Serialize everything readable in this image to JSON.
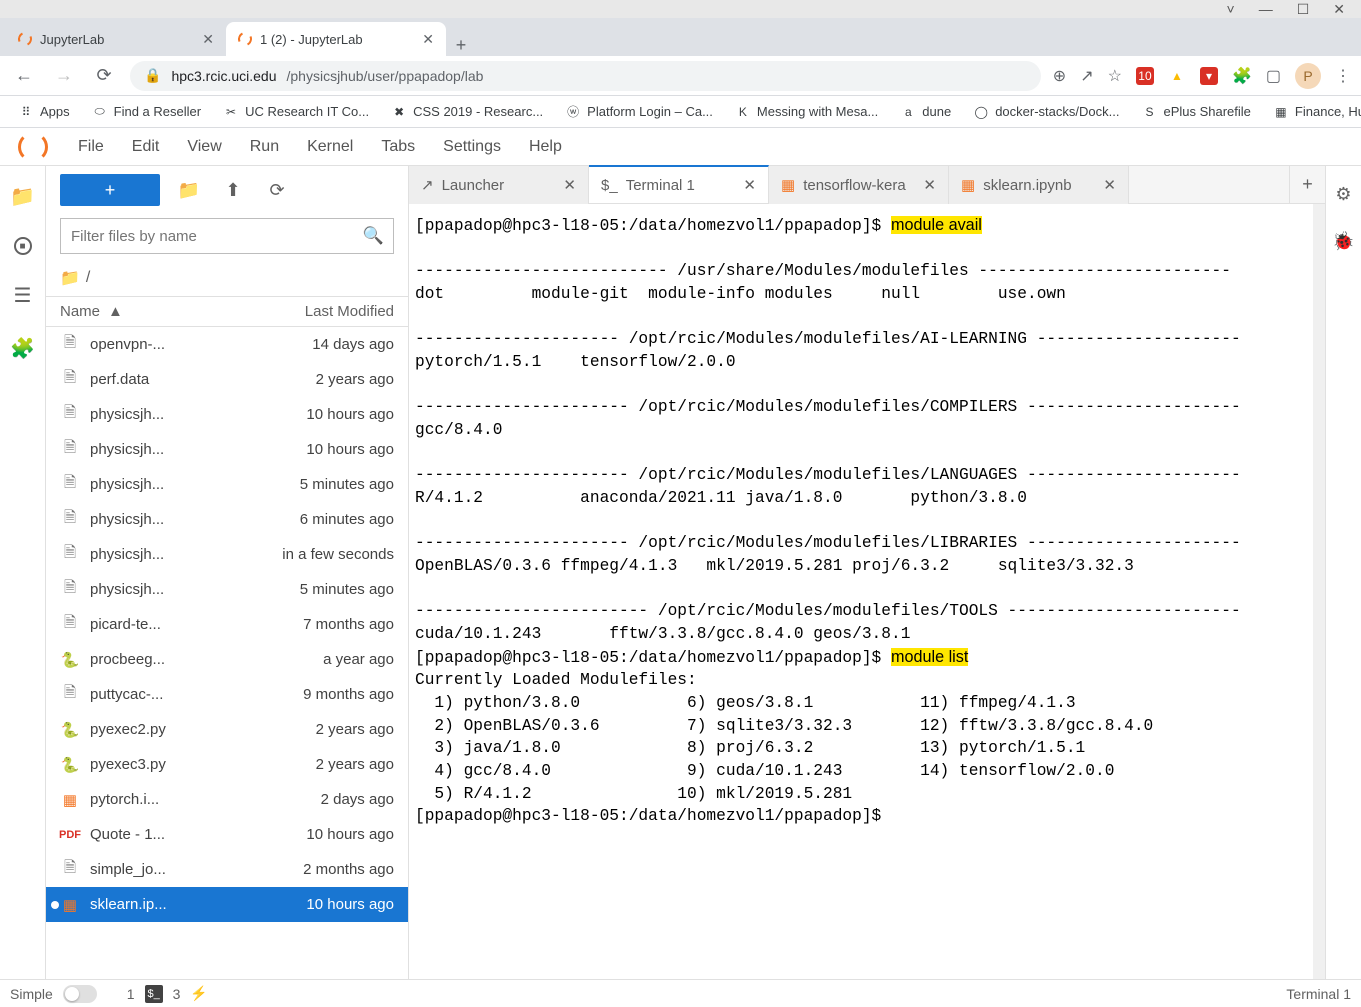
{
  "window": {
    "minimize": "—",
    "maximize": "☐",
    "close": "✕",
    "chevron": "˅"
  },
  "browser_tabs": [
    {
      "title": "JupyterLab",
      "active": false
    },
    {
      "title": "1 (2) - JupyterLab",
      "active": true
    }
  ],
  "address": {
    "secure_icon": "🔒",
    "url_host": "hpc3.rcic.uci.edu",
    "url_path": "/physicsjhub/user/ppapadop/lab"
  },
  "addr_icons": {
    "zoom": "⊕",
    "share": "↗",
    "star": "☆",
    "puzzle": "🧩",
    "panel": "▢",
    "dots": "⋮"
  },
  "bookmarks": [
    {
      "icon": "⠿",
      "label": "Apps"
    },
    {
      "icon": "⬭",
      "label": "Find a Reseller"
    },
    {
      "icon": "✂",
      "label": "UC Research IT Co..."
    },
    {
      "icon": "✖",
      "label": "CSS 2019 - Researc..."
    },
    {
      "icon": "ⓦ",
      "label": "Platform Login – Ca..."
    },
    {
      "icon": "K",
      "label": "Messing with Mesa..."
    },
    {
      "icon": "a",
      "label": "dune"
    },
    {
      "icon": "◯",
      "label": "docker-stacks/Dock..."
    },
    {
      "icon": "S",
      "label": "ePlus Sharefile"
    },
    {
      "icon": "▦",
      "label": "Finance, Human Re..."
    }
  ],
  "menu": [
    "File",
    "Edit",
    "View",
    "Run",
    "Kernel",
    "Tabs",
    "Settings",
    "Help"
  ],
  "filter_placeholder": "Filter files by name",
  "breadcrumb": "/",
  "file_headers": {
    "name": "Name",
    "modified": "Last Modified"
  },
  "files": [
    {
      "icon": "file",
      "name": "openvpn-...",
      "mod": "14 days ago"
    },
    {
      "icon": "file",
      "name": "perf.data",
      "mod": "2 years ago"
    },
    {
      "icon": "file",
      "name": "physicsjh...",
      "mod": "10 hours ago"
    },
    {
      "icon": "file",
      "name": "physicsjh...",
      "mod": "10 hours ago"
    },
    {
      "icon": "file",
      "name": "physicsjh...",
      "mod": "5 minutes ago"
    },
    {
      "icon": "file",
      "name": "physicsjh...",
      "mod": "6 minutes ago"
    },
    {
      "icon": "file",
      "name": "physicsjh...",
      "mod": "in a few seconds"
    },
    {
      "icon": "file",
      "name": "physicsjh...",
      "mod": "5 minutes ago"
    },
    {
      "icon": "file",
      "name": "picard-te...",
      "mod": "7 months ago"
    },
    {
      "icon": "py",
      "name": "procbeeg...",
      "mod": "a year ago"
    },
    {
      "icon": "file",
      "name": "puttycac-...",
      "mod": "9 months ago"
    },
    {
      "icon": "py",
      "name": "pyexec2.py",
      "mod": "2 years ago"
    },
    {
      "icon": "py",
      "name": "pyexec3.py",
      "mod": "2 years ago"
    },
    {
      "icon": "nb",
      "name": "pytorch.i...",
      "mod": "2 days ago"
    },
    {
      "icon": "pdf",
      "name": "Quote - 1...",
      "mod": "10 hours ago"
    },
    {
      "icon": "file",
      "name": "simple_jo...",
      "mod": "2 months ago"
    },
    {
      "icon": "nb",
      "name": "sklearn.ip...",
      "mod": "10 hours ago",
      "selected": true,
      "dirty": true
    }
  ],
  "dock_tabs": [
    {
      "icon": "↗",
      "label": "Launcher",
      "active": false
    },
    {
      "icon": "$_",
      "label": "Terminal 1",
      "active": true
    },
    {
      "icon": "▦",
      "label": "tensorflow-kera",
      "active": false,
      "color": "#f37626"
    },
    {
      "icon": "▦",
      "label": "sklearn.ipynb",
      "active": false,
      "color": "#f37626"
    }
  ],
  "terminal": {
    "prompt1": "[ppapadop@hpc3-l18-05:/data/homezvol1/ppapadop]$ ",
    "cmd1": "module avail",
    "sec1_h": "-------------------------- /usr/share/Modules/modulefiles --------------------------",
    "sec1_b": "dot         module-git  module-info modules     null        use.own",
    "sec2_h": "--------------------- /opt/rcic/Modules/modulefiles/AI-LEARNING ---------------------",
    "sec2_b": "pytorch/1.5.1    tensorflow/2.0.0",
    "sec3_h": "---------------------- /opt/rcic/Modules/modulefiles/COMPILERS ----------------------",
    "sec3_b": "gcc/8.4.0",
    "sec4_h": "---------------------- /opt/rcic/Modules/modulefiles/LANGUAGES ----------------------",
    "sec4_b": "R/4.1.2          anaconda/2021.11 java/1.8.0       python/3.8.0",
    "sec5_h": "---------------------- /opt/rcic/Modules/modulefiles/LIBRARIES ----------------------",
    "sec5_b": "OpenBLAS/0.3.6 ffmpeg/4.1.3   mkl/2019.5.281 proj/6.3.2     sqlite3/3.32.3",
    "sec6_h": "------------------------ /opt/rcic/Modules/modulefiles/TOOLS ------------------------",
    "sec6_b": "cuda/10.1.243       fftw/3.3.8/gcc.8.4.0 geos/3.8.1",
    "prompt2": "[ppapadop@hpc3-l18-05:/data/homezvol1/ppapadop]$ ",
    "cmd2": "module list",
    "loaded_h": "Currently Loaded Modulefiles:",
    "loaded_1": "  1) python/3.8.0           6) geos/3.8.1           11) ffmpeg/4.1.3",
    "loaded_2": "  2) OpenBLAS/0.3.6         7) sqlite3/3.32.3       12) fftw/3.3.8/gcc.8.4.0",
    "loaded_3": "  3) java/1.8.0             8) proj/6.3.2           13) pytorch/1.5.1",
    "loaded_4": "  4) gcc/8.4.0              9) cuda/10.1.243        14) tensorflow/2.0.0",
    "loaded_5": "  5) R/4.1.2               10) mkl/2019.5.281",
    "prompt3": "[ppapadop@hpc3-l18-05:/data/homezvol1/ppapadop]$"
  },
  "status": {
    "simple": "Simple",
    "term_count": "1",
    "kernel_count": "3",
    "right": "Terminal 1"
  }
}
